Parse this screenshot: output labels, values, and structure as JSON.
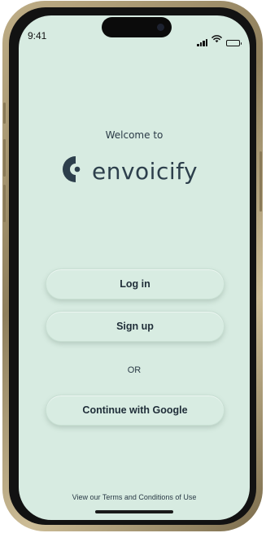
{
  "status_bar": {
    "time": "9:41",
    "icons": [
      "cellular-signal-icon",
      "wifi-icon",
      "battery-icon"
    ]
  },
  "welcome": {
    "heading": "Welcome to",
    "app_name": "envoicify",
    "logo_icon": "envoicify-logo-icon"
  },
  "actions": {
    "login_label": "Log in",
    "signup_label": "Sign up",
    "divider_label": "OR",
    "google_label": "Continue with Google"
  },
  "footer": {
    "terms_text": "View our Terms and Conditions of Use"
  },
  "colors": {
    "screen_background": "#d7ebe1",
    "brand_text": "#2d3f4c",
    "button_background": "#d8ece2",
    "frame": "#bfae87"
  }
}
